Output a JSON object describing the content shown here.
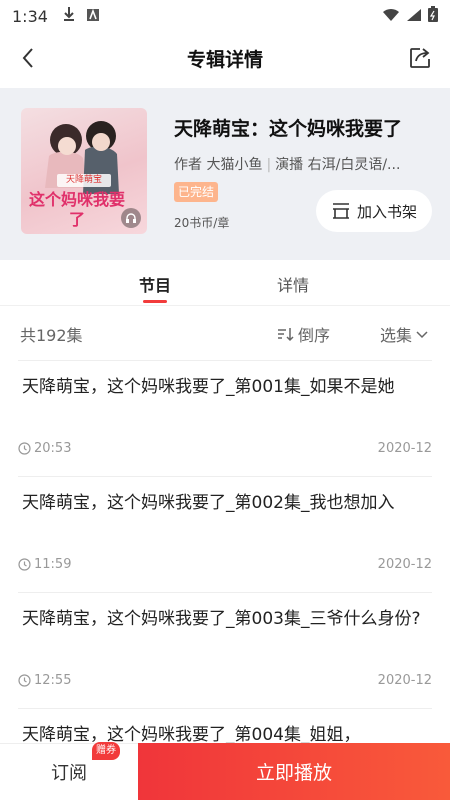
{
  "status_bar": {
    "time": "1:34"
  },
  "header": {
    "title": "专辑详情"
  },
  "album": {
    "title": "天降萌宝：这个妈咪我要了",
    "author_label": "作者",
    "author": "大猫小鱼",
    "narrator_label": "演播",
    "narrators": "右洱/白灵语/...",
    "status_badge": "已完结",
    "price": "20书币/章",
    "cover_text_top": "天降萌宝",
    "cover_text_main": "这个妈咪我要了",
    "shelf_button": "加入书架"
  },
  "tabs": [
    {
      "label": "节目",
      "active": true
    },
    {
      "label": "详情",
      "active": false
    }
  ],
  "list_bar": {
    "count": "共192集",
    "sort_label": "倒序",
    "select_label": "选集"
  },
  "episodes": [
    {
      "title": "天降萌宝，这个妈咪我要了_第001集_如果不是她",
      "duration": "20:53",
      "date": "2020-12"
    },
    {
      "title": "天降萌宝，这个妈咪我要了_第002集_我也想加入",
      "duration": "11:59",
      "date": "2020-12"
    },
    {
      "title": "天降萌宝，这个妈咪我要了_第003集_三爷什么身份?",
      "duration": "12:55",
      "date": "2020-12"
    },
    {
      "title": "天降萌宝，这个妈咪我要了_第004集_姐姐，",
      "duration": "",
      "date": ""
    }
  ],
  "bottom_bar": {
    "subscribe": "订阅",
    "coupon": "赠券",
    "play": "立即播放"
  },
  "colors": {
    "accent": "#f23b3b",
    "badge": "#fdb58d",
    "album_bg": "#eef0f4"
  }
}
